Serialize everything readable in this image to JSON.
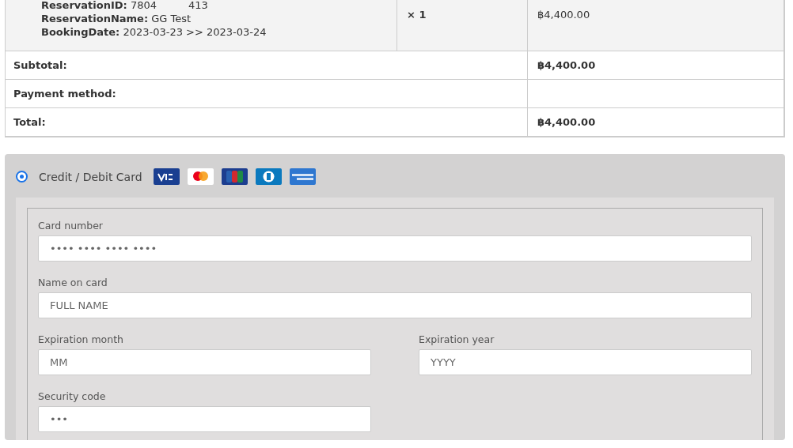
{
  "order_item": {
    "details": [
      {
        "label": "ReservationID:",
        "value": "7804",
        "extra": "413"
      },
      {
        "label": "ReservationName:",
        "value": "GG Test"
      },
      {
        "label": "BookingDate:",
        "value": "2023-03-23 >> 2023-03-24"
      }
    ],
    "quantity": "× 1",
    "price": "฿4,400.00"
  },
  "totals": [
    {
      "label": "Subtotal:",
      "value": "฿4,400.00"
    },
    {
      "label": "Payment method:"
    },
    {
      "label": "Total:",
      "value": "฿4,400.00"
    }
  ],
  "payment": {
    "option": {
      "label": "Credit / Debit Card",
      "selected": true
    },
    "fields": [
      {
        "label": "Card number",
        "placeholder": "•••• •••• •••• ••••",
        "kind": "wide"
      },
      {
        "label": "Name on card",
        "placeholder": "FULL NAME",
        "kind": "wide"
      },
      {
        "label": "Expiration month",
        "placeholder": "MM",
        "kind": "narrow"
      },
      {
        "label": "Expiration year",
        "placeholder": "YYYY",
        "kind": "narrow"
      },
      {
        "label": "Security code",
        "placeholder": "•••",
        "kind": "narrow"
      }
    ]
  }
}
